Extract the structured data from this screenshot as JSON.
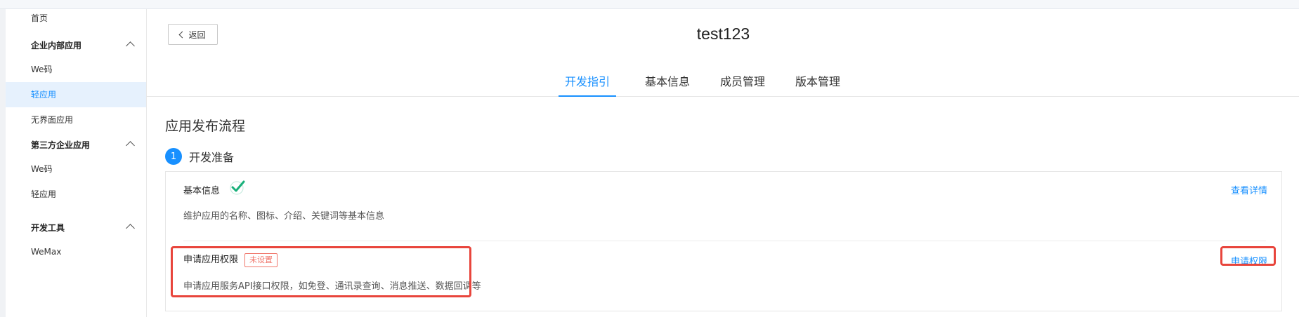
{
  "sidebar": {
    "home": "首页",
    "groups": [
      {
        "label": "企业内部应用",
        "items": [
          "We码",
          "轻应用",
          "无界面应用"
        ]
      },
      {
        "label": "第三方企业应用",
        "items": [
          "We码",
          "轻应用"
        ]
      },
      {
        "label": "开发工具",
        "items": [
          "WeMax"
        ]
      }
    ],
    "active_item": "轻应用"
  },
  "header": {
    "back_label": "返回",
    "app_title": "test123"
  },
  "tabs": [
    {
      "label": "开发指引",
      "active": true
    },
    {
      "label": "基本信息",
      "active": false
    },
    {
      "label": "成员管理",
      "active": false
    },
    {
      "label": "版本管理",
      "active": false
    }
  ],
  "main": {
    "section_title": "应用发布流程",
    "step": {
      "number": "1",
      "label": "开发准备"
    },
    "rows": [
      {
        "title": "基本信息",
        "status_icon": "check-icon",
        "desc": "维护应用的名称、图标、介绍、关键词等基本信息",
        "action": "查看详情"
      },
      {
        "title": "申请应用权限",
        "badge": "未设置",
        "desc": "申请应用服务API接口权限，如免登、通讯录查询、消息推送、数据回调等",
        "action": "申请权限"
      }
    ]
  },
  "colors": {
    "accent": "#1890ff",
    "warning_badge": "#f0776c",
    "highlight_box": "#e8453c",
    "check": "#18b07a"
  }
}
